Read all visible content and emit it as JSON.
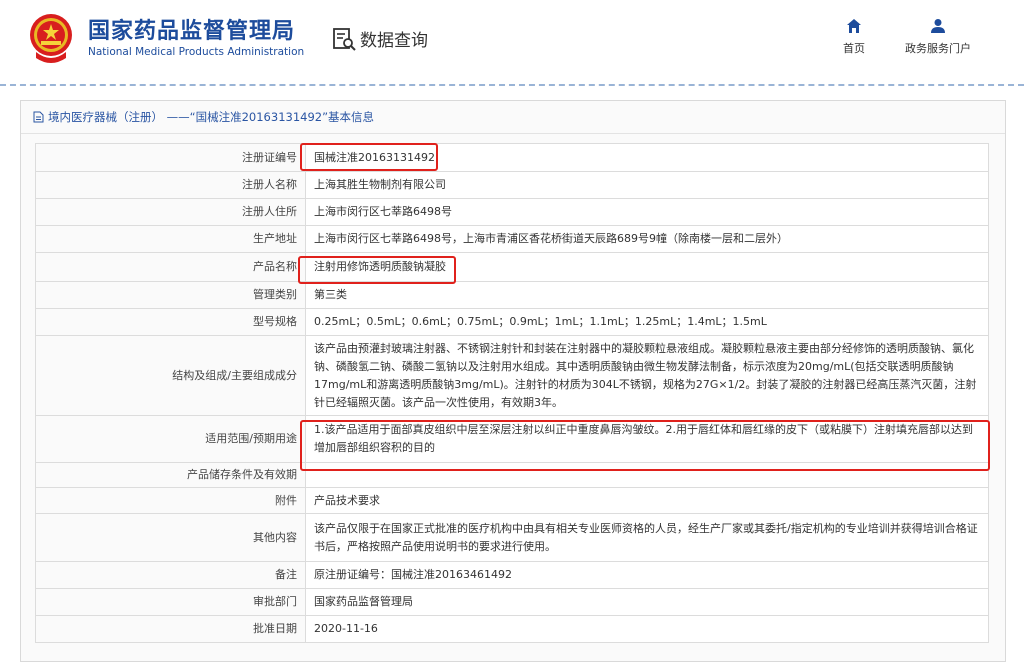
{
  "header": {
    "agency_cn": "国家药品监督管理局",
    "agency_en": "National Medical Products Administration",
    "query_label": "数据查询",
    "nav": [
      {
        "label": "首页",
        "icon": "home-icon"
      },
      {
        "label": "政务服务门户",
        "icon": "user-icon"
      }
    ]
  },
  "panel": {
    "title": "境内医疗器械（注册） ——“国械注准20163131492”基本信息"
  },
  "record": [
    {
      "key": "注册证编号",
      "value": "国械注准20163131492"
    },
    {
      "key": "注册人名称",
      "value": "上海其胜生物制剂有限公司"
    },
    {
      "key": "注册人住所",
      "value": "上海市闵行区七莘路6498号"
    },
    {
      "key": "生产地址",
      "value": "上海市闵行区七莘路6498号，上海市青浦区香花桥街道天辰路689号9幢（除南楼一层和二层外）"
    },
    {
      "key": "产品名称",
      "value": "注射用修饰透明质酸钠凝胶"
    },
    {
      "key": "管理类别",
      "value": "第三类"
    },
    {
      "key": "型号规格",
      "value": "0.25mL；0.5mL；0.6mL；0.75mL；0.9mL；1mL；1.1mL；1.25mL；1.4mL；1.5mL"
    },
    {
      "key": "结构及组成/主要组成成分",
      "value": "该产品由预灌封玻璃注射器、不锈钢注射针和封装在注射器中的凝胶颗粒悬液组成。凝胶颗粒悬液主要由部分经修饰的透明质酸钠、氯化钠、磷酸氢二钠、磷酸二氢钠以及注射用水组成。其中透明质酸钠由微生物发酵法制备，标示浓度为20mg/mL(包括交联透明质酸钠17mg/mL和游离透明质酸钠3mg/mL)。注射针的材质为304L不锈钢，规格为27G×1/2。封装了凝胶的注射器已经高压蒸汽灭菌，注射针已经辐照灭菌。该产品一次性使用，有效期3年。"
    },
    {
      "key": "适用范围/预期用途",
      "value": "1.该产品适用于面部真皮组织中层至深层注射以纠正中重度鼻唇沟皱纹。2.用于唇红体和唇红缘的皮下（或粘膜下）注射填充唇部以达到增加唇部组织容积的目的"
    },
    {
      "key": "产品储存条件及有效期",
      "value": ""
    },
    {
      "key": "附件",
      "value": "产品技术要求"
    },
    {
      "key": "其他内容",
      "value": "该产品仅限于在国家正式批准的医疗机构中由具有相关专业医师资格的人员，经生产厂家或其委托/指定机构的专业培训并获得培训合格证书后，严格按照产品使用说明书的要求进行使用。"
    },
    {
      "key": "备注",
      "value": "原注册证编号：国械注准20163461492"
    },
    {
      "key": "审批部门",
      "value": "国家药品监督管理局"
    },
    {
      "key": "批准日期",
      "value": "2020-11-16"
    }
  ],
  "colors": {
    "brand": "#1d4c9c",
    "highlight": "#e0211c"
  }
}
